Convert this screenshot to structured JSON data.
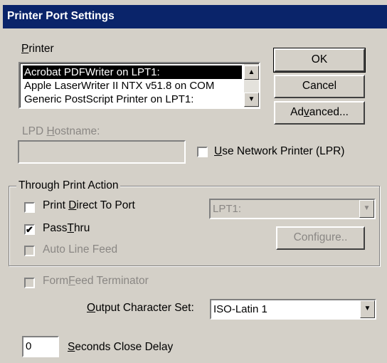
{
  "window": {
    "title": "Printer Port Settings"
  },
  "printer": {
    "label": "Printer",
    "label_u": "P",
    "label_rest": "rinter",
    "items": [
      "Acrobat PDFWriter on LPT1:",
      "Apple LaserWriter II NTX v51.8 on COM",
      "Generic PostScript Printer on LPT1:"
    ],
    "selected_index": 0
  },
  "buttons": {
    "ok": "OK",
    "cancel": "Cancel",
    "advanced_pre": "Ad",
    "advanced_u": "v",
    "advanced_post": "anced..."
  },
  "lpd": {
    "label_pre": "LPD ",
    "label_u": "H",
    "label_post": "ostname:",
    "value": "",
    "use_network_pre": "",
    "use_network_u": "U",
    "use_network_post": "se Network Printer (LPR)",
    "use_network_checked": false
  },
  "through": {
    "group_label": "Through Print Action",
    "print_direct_pre": "Print ",
    "print_direct_u": "D",
    "print_direct_post": "irect To Port",
    "print_direct_checked": false,
    "port_value": "LPT1:",
    "passthru_pre": "Pass",
    "passthru_u": "T",
    "passthru_post": "hru",
    "passthru_checked": true,
    "passthru_mark": "✔",
    "configure": "Configure..",
    "auto_line_feed": "Auto Line Feed",
    "auto_line_feed_checked": false
  },
  "formfeed": {
    "pre": "Form",
    "u": "F",
    "post": "eed Terminator",
    "checked": false
  },
  "output_charset": {
    "label_pre": "",
    "label_u": "O",
    "label_post": "utput Character Set:",
    "value": "ISO-Latin 1"
  },
  "close_delay": {
    "value": "0",
    "label_pre": "",
    "label_u": "S",
    "label_post": "econds Close Delay"
  },
  "icons": {
    "scroll_up": "▲",
    "scroll_down": "▼",
    "dropdown": "▼"
  }
}
